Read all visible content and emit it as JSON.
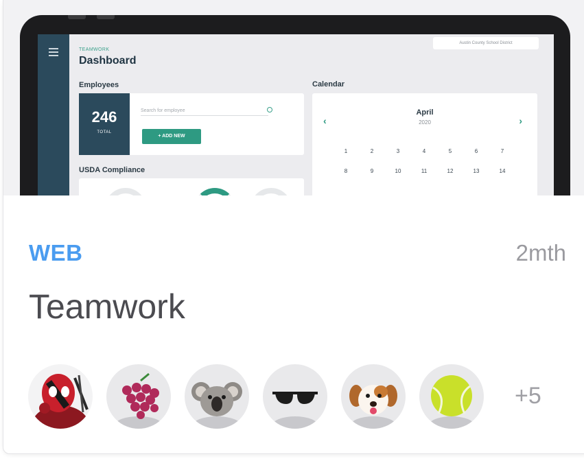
{
  "preview": {
    "kicker": "TEAMWORK",
    "title": "Dashboard",
    "district": "Austin County School District",
    "employees_label": "Employees",
    "employee_count": "246",
    "employee_count_unit": "TOTAL",
    "search_placeholder": "Search for employee",
    "add_button": "+ ADD NEW",
    "usda_label": "USDA Compliance",
    "calendar_label": "Calendar",
    "calendar_month": "April",
    "calendar_year": "2020",
    "calendar_days": [
      "1",
      "2",
      "3",
      "4",
      "5",
      "6",
      "7",
      "8",
      "9",
      "10",
      "11",
      "12",
      "13",
      "14"
    ]
  },
  "card": {
    "category": "WEB",
    "age": "2mth",
    "title": "Teamwork",
    "more_members": "+5"
  },
  "members": [
    {
      "icon": "deadpool-avatar"
    },
    {
      "icon": "grapes-avatar"
    },
    {
      "icon": "koala-avatar"
    },
    {
      "icon": "sunglasses-avatar"
    },
    {
      "icon": "dog-avatar"
    },
    {
      "icon": "tennis-ball-avatar"
    }
  ],
  "colors": {
    "category": "#4a9cf0",
    "accent": "#2e9a82",
    "sidebar": "#2b4a5c"
  }
}
